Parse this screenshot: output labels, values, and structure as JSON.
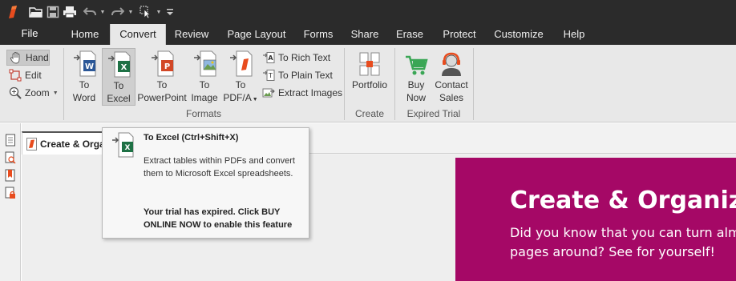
{
  "quick_access": {
    "icons": [
      "app-logo-icon",
      "open-folder-icon",
      "save-icon",
      "print-icon",
      "undo-icon",
      "redo-icon",
      "select-cursor-icon",
      "customize-toolbar-icon"
    ]
  },
  "menu": {
    "file": "File",
    "tabs": [
      "Home",
      "Convert",
      "Review",
      "Page Layout",
      "Forms",
      "Share",
      "Erase",
      "Protect",
      "Customize",
      "Help"
    ],
    "active_tab": "Convert"
  },
  "ribbon": {
    "tools": {
      "hand": "Hand",
      "edit": "Edit",
      "zoom": "Zoom"
    },
    "formats": {
      "to_word": "To\nWord",
      "to_word_l1": "To",
      "to_word_l2": "Word",
      "to_excel_l1": "To",
      "to_excel_l2": "Excel",
      "to_ppt_l1": "To",
      "to_ppt_l2": "PowerPoint",
      "to_image_l1": "To",
      "to_image_l2": "Image",
      "to_pdfa_l1": "To",
      "to_pdfa_l2": "PDF/A",
      "to_rich_text": "To Rich Text",
      "to_plain_text": "To Plain Text",
      "extract_images": "Extract Images",
      "group_label": "Formats"
    },
    "create": {
      "portfolio": "Portfolio",
      "group_label": "Create"
    },
    "trial": {
      "buy_l1": "Buy",
      "buy_l2": "Now",
      "contact_l1": "Contact",
      "contact_l2": "Sales",
      "group_label": "Expired Trial"
    }
  },
  "document": {
    "tab_title": "Create & Organize",
    "page_title": "Create & Organize",
    "page_line1": "Did you know that you can turn almost",
    "page_line2": "pages around? See for yourself!",
    "accent_color": "#a50866"
  },
  "tooltip": {
    "title": "To Excel (Ctrl+Shift+X)",
    "description": "Extract tables within PDFs and convert them to Microsoft Excel spreadsheets.",
    "warning": "Your trial has expired. Click BUY ONLINE NOW to enable this feature"
  },
  "colors": {
    "titlebar": "#2b2b2b",
    "ribbon": "#e8e8e8",
    "word_blue": "#2b5797",
    "excel_green": "#1e7145",
    "ppt_red": "#d24726",
    "buy_green": "#3aa655"
  }
}
